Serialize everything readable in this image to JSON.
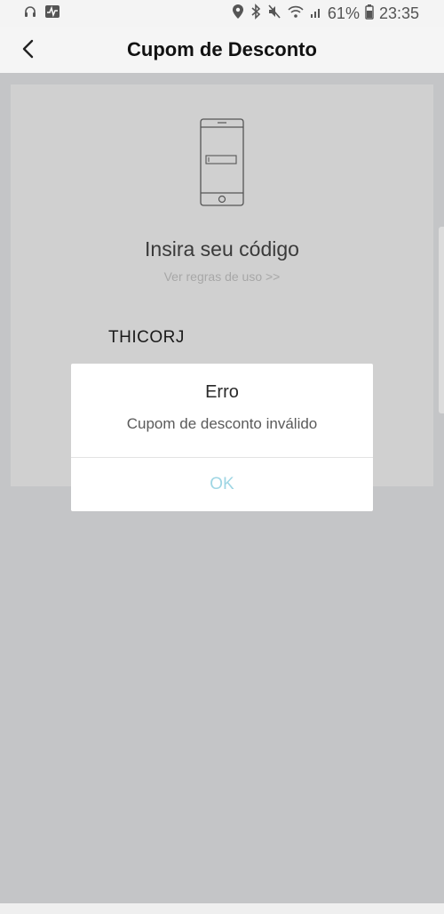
{
  "status_bar": {
    "battery": "61%",
    "time": "23:35",
    "icons": [
      "headset-icon",
      "activity-icon",
      "location-icon",
      "bluetooth-icon",
      "mute-icon",
      "wifi-icon",
      "signal-icon",
      "battery-icon"
    ]
  },
  "header": {
    "title": "Cupom de Desconto",
    "back_icon": "chevron-left-icon"
  },
  "coupon_card": {
    "illustration_icon": "phone-icon",
    "title": "Insira seu código",
    "rules_link": "Ver regras de uso >>",
    "entered_code": "THICORJ"
  },
  "dialog": {
    "title": "Erro",
    "message": "Cupom de desconto inválido",
    "ok_label": "OK"
  },
  "colors": {
    "overlay": "#c4c5c7",
    "card": "#d0d0d0",
    "ok_text": "#9fd6e4"
  }
}
